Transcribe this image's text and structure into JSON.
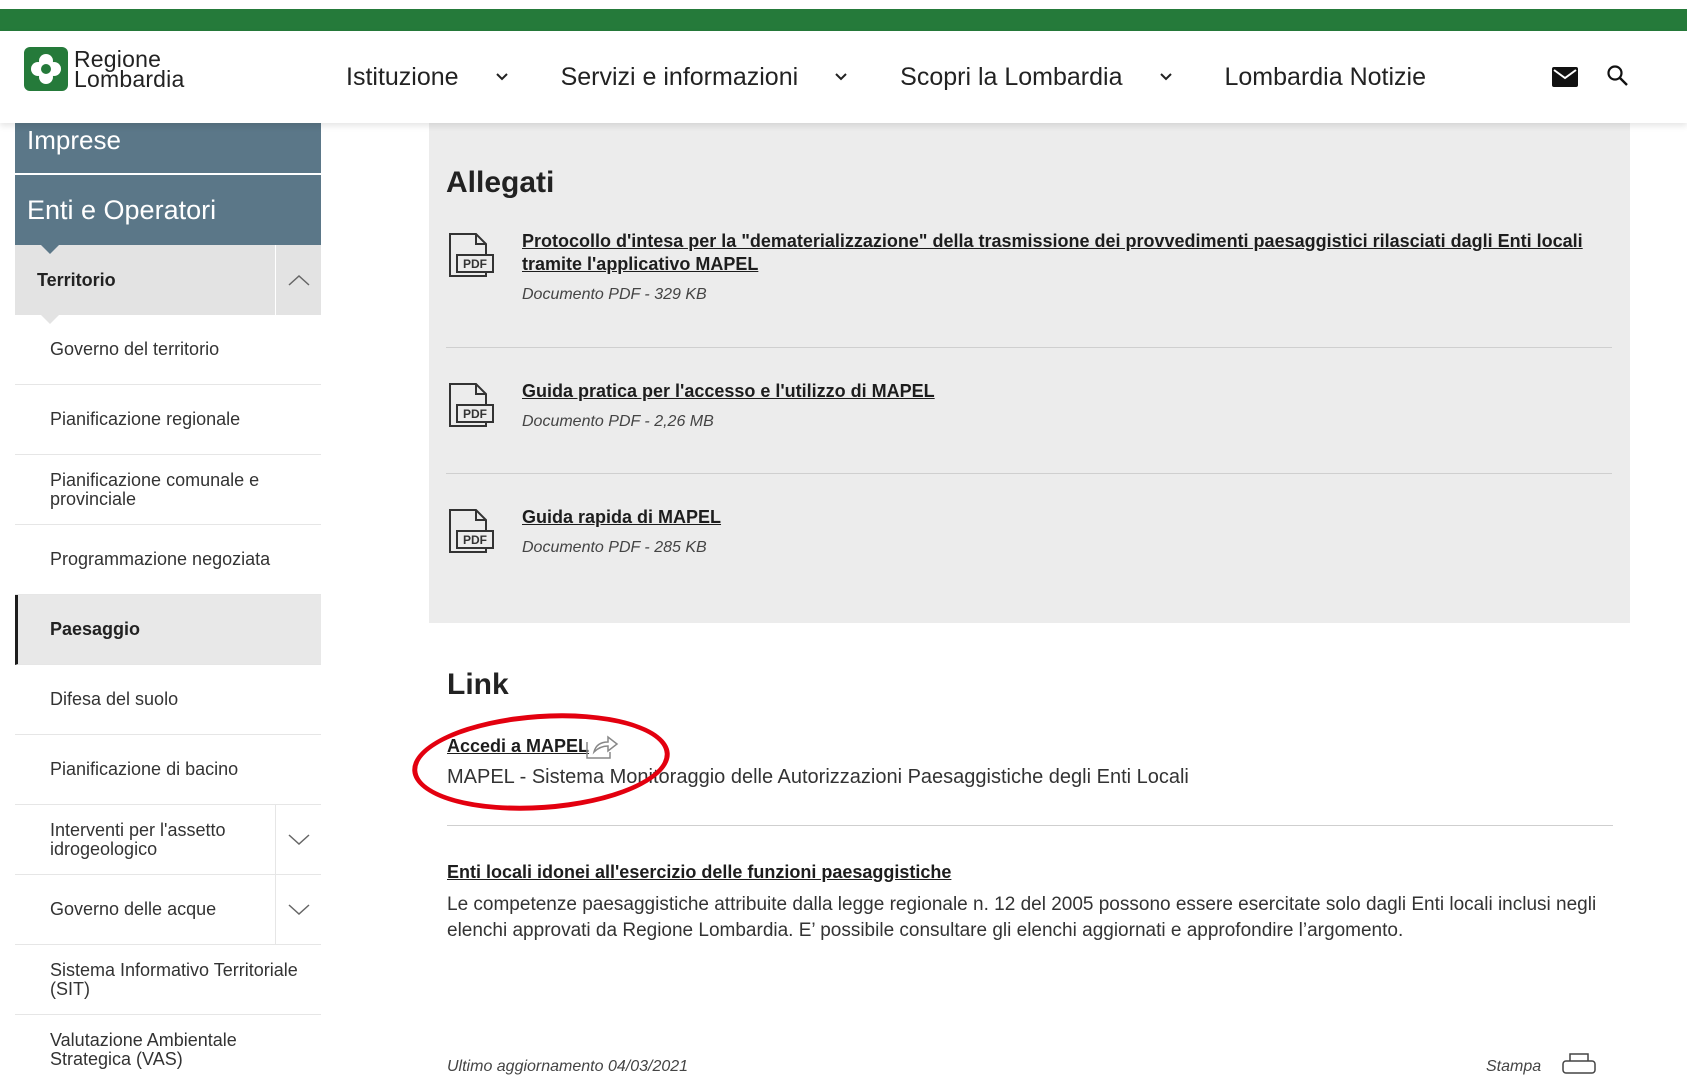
{
  "header": {
    "brand_color": "#257a3a",
    "logo_line1": "Regione",
    "logo_line2": "Lombardia",
    "nav": [
      {
        "label": "Istituzione",
        "dropdown": true
      },
      {
        "label": "Servizi e informazioni",
        "dropdown": true
      },
      {
        "label": "Scopri la Lombardia",
        "dropdown": true
      },
      {
        "label": "Lombardia Notizie",
        "dropdown": false
      }
    ],
    "icons": [
      "mail-icon",
      "search-icon"
    ]
  },
  "sidebar": {
    "imprese": "Imprese",
    "enti": "Enti e Operatori",
    "section": "Territorio",
    "items": [
      {
        "label": "Governo del territorio"
      },
      {
        "label": "Pianificazione regionale"
      },
      {
        "label": "Pianificazione comunale e provinciale"
      },
      {
        "label": "Programmazione negoziata"
      },
      {
        "label": "Paesaggio",
        "active": true
      },
      {
        "label": "Difesa del suolo"
      },
      {
        "label": "Pianificazione di bacino"
      },
      {
        "label": "Interventi per l'assetto idrogeologico",
        "expandable": true
      },
      {
        "label": "Governo delle acque",
        "expandable": true
      },
      {
        "label": "Sistema Informativo Territoriale (SIT)"
      },
      {
        "label": "Valutazione Ambientale Strategica (VAS)"
      }
    ]
  },
  "allegati": {
    "title": "Allegati",
    "items": [
      {
        "title": "Protocollo d'intesa per la \"dematerializzazione\" della trasmissione dei provvedimenti paesaggistici rilasciati dagli Enti locali tramite l'applicativo MAPEL",
        "meta": "Documento PDF - 329 KB",
        "icon": "pdf-icon"
      },
      {
        "title": "Guida pratica per l'accesso e l'utilizzo di MAPEL",
        "meta": "Documento PDF - 2,26 MB",
        "icon": "pdf-icon"
      },
      {
        "title": "Guida rapida di MAPEL",
        "meta": "Documento PDF - 285 KB",
        "icon": "pdf-icon"
      }
    ],
    "pdf_label": "PDF"
  },
  "links": {
    "title": "Link",
    "accedi": "Accedi a MAPEL",
    "accedi_desc": "MAPEL - Sistema Monitoraggio delle Autorizzazioni Paesaggistiche degli Enti Locali",
    "enti_title": "Enti locali idonei all'esercizio delle funzioni paesaggistiche",
    "enti_desc": "Le competenze paesaggistiche attribuite dalla legge regionale n. 12 del 2005 possono essere esercitate solo dagli Enti locali inclusi negli elenchi approvati da Regione Lombardia. E’ possibile consultare gli elenchi aggiornati e approfondire l’argomento."
  },
  "footer": {
    "updated": "Ultimo aggiornamento 04/03/2021",
    "print": "Stampa"
  },
  "annotation_color": "#e3000f"
}
